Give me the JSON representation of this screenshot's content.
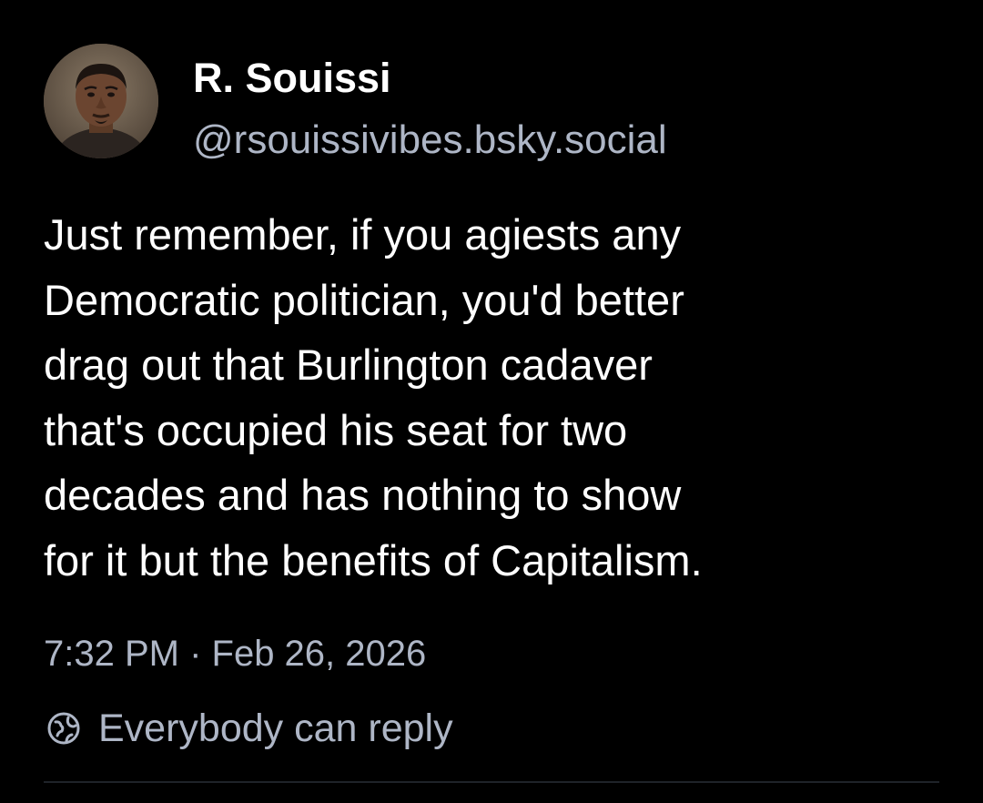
{
  "post": {
    "author": {
      "display_name": "R. Souissi",
      "handle": "@rsouissivibes.bsky.social"
    },
    "text_lines": [
      "Just remember, if you agiests any",
      "Democratic politician, you'd better",
      "drag out that Burlington cadaver",
      "that's occupied his seat for two",
      "decades and has nothing to show",
      "for it but the benefits of Capitalism."
    ],
    "timestamp": "7:32 PM · Feb 26, 2026",
    "reply_setting": {
      "icon": "globe-icon",
      "label": "Everybody can reply"
    }
  },
  "colors": {
    "background": "#000000",
    "text": "#ffffff",
    "muted": "#aeb6c6",
    "divider": "#1f2329"
  }
}
